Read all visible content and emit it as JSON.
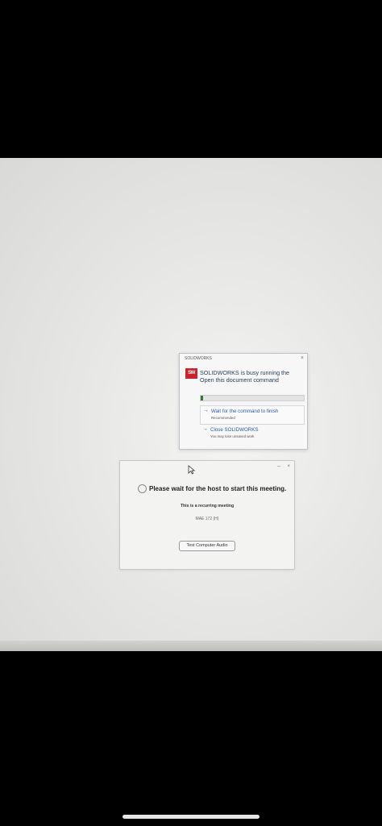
{
  "solidworks_dialog": {
    "title": "SOLIDWORKS",
    "close_glyph": "×",
    "logo_text": "SW",
    "message": "SOLIDWORKS is busy running the Open this document command",
    "progress": 0.02,
    "options": [
      {
        "arrow": "→",
        "label": "Wait for the command to finish",
        "sublabel": "Recommended"
      },
      {
        "arrow": "→",
        "label": "Close SOLIDWORKS",
        "sublabel": "You may lose unsaved work"
      }
    ]
  },
  "meeting_dialog": {
    "minimize_glyph": "–",
    "close_glyph": "×",
    "heading": "Please wait for the host to start this meeting.",
    "recurring_text": "This is a recurring meeting",
    "meeting_name": "MAE 172 (H)",
    "test_audio_label": "Test Computer Audio"
  },
  "icons": [
    "solidworks-logo-icon",
    "arrow-right-icon",
    "cursor-arrow-icon",
    "loading-spinner-icon",
    "minimize-icon",
    "close-icon"
  ]
}
